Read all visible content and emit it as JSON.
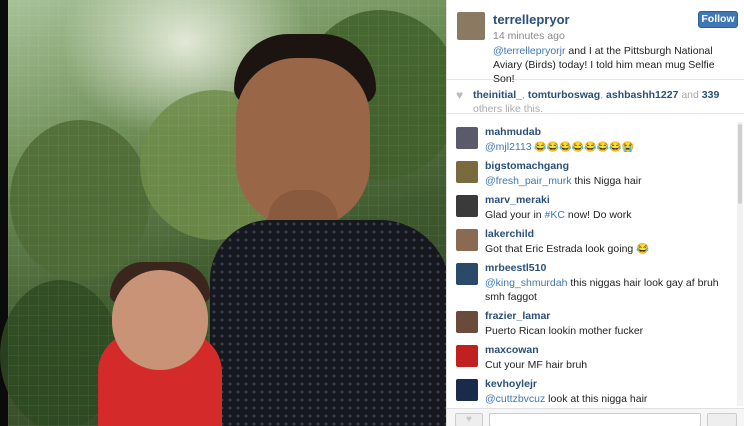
{
  "post": {
    "username": "terrellepryor",
    "time": "14 minutes ago",
    "follow_label": "Follow",
    "caption_mention": "@terrellepryorjr",
    "caption_text": " and I at the Pittsburgh National Aviary (Birds) today! I told him mean mug Selfie Son!"
  },
  "likes": {
    "user1": "theinitial_",
    "user2": "tomturboswag",
    "user3": "ashbashh1227",
    "and": ", ",
    "and2": ", ",
    "connector": " and ",
    "count": "339",
    "suffix": " others like this."
  },
  "comments": [
    {
      "user": "mahmudab",
      "mention": "@mjl2113",
      "text": " 😂😂😂😂😂😂😂😭",
      "avatar_color": "#5a5a6a"
    },
    {
      "user": "bigstomachgang",
      "mention": "@fresh_pair_murk",
      "text": " this Nigga hair",
      "avatar_color": "#7a6a40"
    },
    {
      "user": "marv_meraki",
      "mention": "",
      "text": "Glad your in #KC now! Do work",
      "text_before": "Glad your in ",
      "hashtag": "#KC",
      "text_after": " now! Do work",
      "avatar_color": "#3a3a3a"
    },
    {
      "user": "lakerchild",
      "mention": "",
      "text": "Got that Eric Estrada look going 😂",
      "avatar_color": "#8a6a50"
    },
    {
      "user": "mrbeestl510",
      "mention": "@king_shmurdah",
      "text": " this niggas hair look gay af bruh smh faggot",
      "avatar_color": "#2a4a6a"
    },
    {
      "user": "frazier_lamar",
      "mention": "",
      "text": "Puerto Rican lookin mother fucker",
      "avatar_color": "#6a4a3a"
    },
    {
      "user": "maxcowan",
      "mention": "",
      "text": "Cut your MF hair bruh",
      "avatar_color": "#c02020"
    },
    {
      "user": "kevhoylejr",
      "mention": "@cuttzbvcuz",
      "text": " look at this nigga hair",
      "avatar_color": "#1a2a4a"
    }
  ],
  "colors": {
    "link": "#2a4f7a",
    "mention": "#3f77b5",
    "follow_bg": "#3f77b5"
  }
}
